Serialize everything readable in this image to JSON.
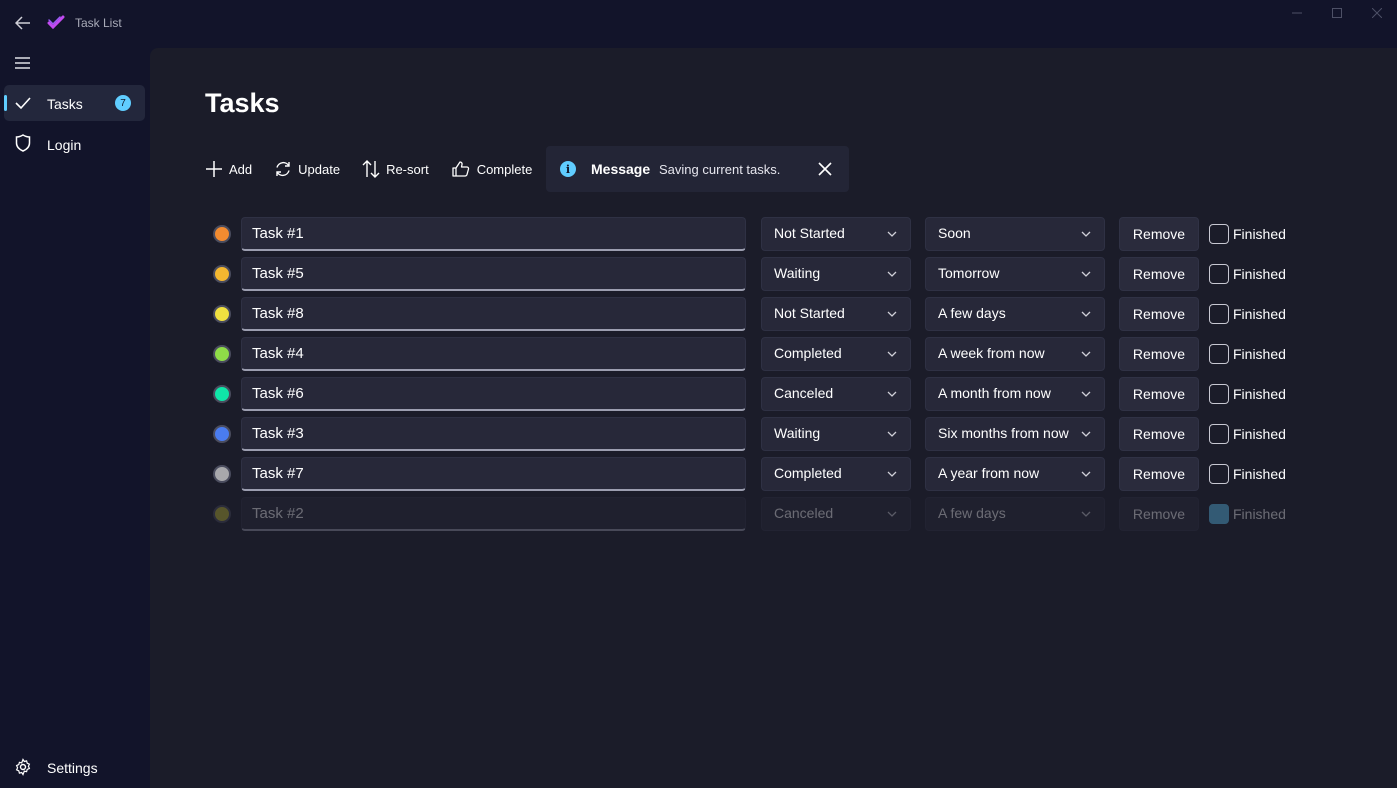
{
  "titlebar": {
    "app_title": "Task List",
    "back_icon": "arrow-left-icon",
    "app_icon": "checkmark-app-icon",
    "controls": [
      "minimize-icon",
      "maximize-icon",
      "close-icon"
    ]
  },
  "sidebar": {
    "items": [
      {
        "label": "Tasks",
        "icon": "checkmark-icon",
        "badge": "7",
        "active": true
      },
      {
        "label": "Login",
        "icon": "shield-icon",
        "active": false
      }
    ],
    "settings_label": "Settings",
    "settings_icon": "gear-icon"
  },
  "page": {
    "title": "Tasks"
  },
  "toolbar": {
    "add_label": "Add",
    "update_label": "Update",
    "resort_label": "Re-sort",
    "complete_label": "Complete"
  },
  "infobar": {
    "title": "Message",
    "message": "Saving current tasks.",
    "icon": "info-icon"
  },
  "remove_label": "Remove",
  "finished_label": "Finished",
  "tasks": [
    {
      "name": "Task #1",
      "color": "#f28b30",
      "status": "Not Started",
      "when": "Soon",
      "finished": false
    },
    {
      "name": "Task #5",
      "color": "#f4b730",
      "status": "Waiting",
      "when": "Tomorrow",
      "finished": false
    },
    {
      "name": "Task #8",
      "color": "#f0e040",
      "status": "Not Started",
      "when": "A few days",
      "finished": false
    },
    {
      "name": "Task #4",
      "color": "#8fdc48",
      "status": "Completed",
      "when": "A week from now",
      "finished": false
    },
    {
      "name": "Task #6",
      "color": "#10e6a8",
      "status": "Canceled",
      "when": "A month from now",
      "finished": false
    },
    {
      "name": "Task #3",
      "color": "#4a7cf0",
      "status": "Waiting",
      "when": "Six months from now",
      "finished": false
    },
    {
      "name": "Task #7",
      "color": "#a8a8ac",
      "status": "Completed",
      "when": "A year from now",
      "finished": false
    },
    {
      "name": "Task #2",
      "color": "#c8c030",
      "status": "Canceled",
      "when": "A few days",
      "finished": true
    }
  ]
}
